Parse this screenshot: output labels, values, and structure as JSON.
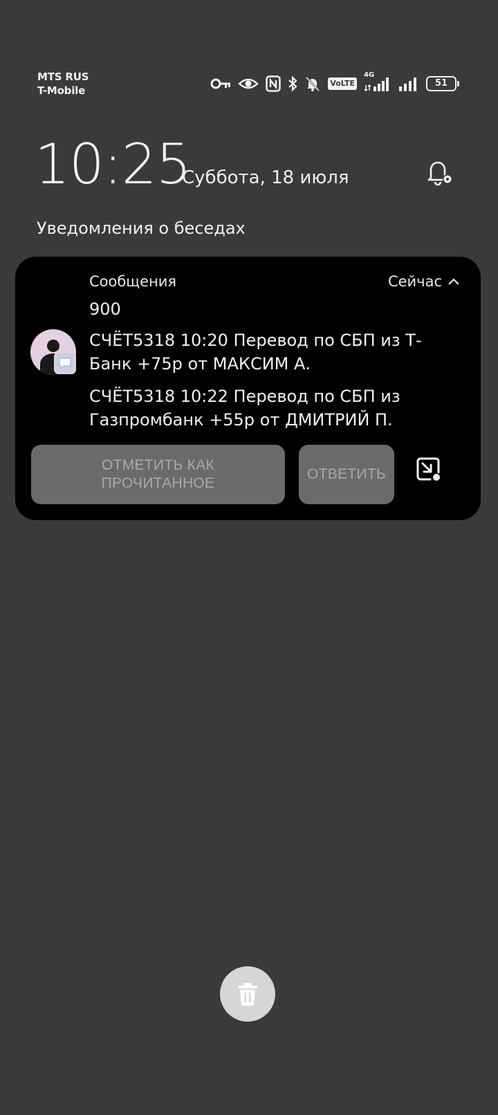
{
  "status_bar": {
    "carrier_1": "MTS RUS",
    "carrier_2": "T-Mobile",
    "volte_label": "VoLTE",
    "network_label": "4G",
    "battery_level": "51"
  },
  "lockscreen": {
    "time": "10:25",
    "date": "Суббота, 18 июля",
    "section_title": "Уведомления о беседах"
  },
  "notification": {
    "app_name": "Сообщения",
    "time_label": "Сейчас",
    "sender": "900",
    "messages": [
      "СЧЁТ5318 10:20 Перевод по СБП из Т-Банк +75р от МАКСИМ А.",
      "СЧЁТ5318 10:22 Перевод по СБП из Газпромбанк +55р от ДМИТРИЙ П."
    ],
    "actions": {
      "mark_read": "ОТМЕТИТЬ КАК ПРОЧИТАННОЕ",
      "reply": "ОТВЕТИТЬ"
    }
  },
  "icons": {
    "status": [
      "key-icon",
      "eye-icon",
      "nfc-icon",
      "bluetooth-icon",
      "bell-off-icon",
      "volte-icon",
      "signal-4g-icon",
      "signal-icon",
      "battery-icon"
    ],
    "notification_settings": "bell-settings-icon",
    "expand": "chevron-up-icon",
    "open": "open-in-app-icon",
    "clear": "trash-icon"
  },
  "colors": {
    "background": "#3a3a3a",
    "card": "#000000",
    "button": "#6b6b6b",
    "avatar": "#e6cfe3"
  }
}
